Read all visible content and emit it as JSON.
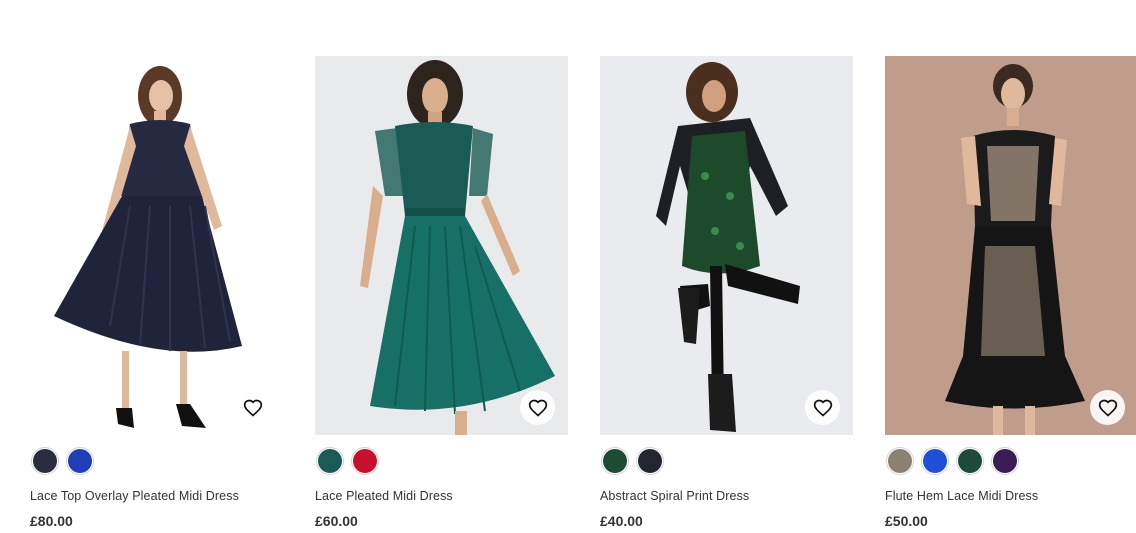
{
  "products": [
    {
      "name": "Lace Top Overlay Pleated Midi Dress",
      "price": "£80.00",
      "swatches": [
        {
          "color": "#2a2d3e"
        },
        {
          "color": "#1f3fb8"
        }
      ]
    },
    {
      "name": "Lace Pleated Midi Dress",
      "price": "£60.00",
      "swatches": [
        {
          "color": "#1b5a55"
        },
        {
          "color": "#c8102e"
        }
      ]
    },
    {
      "name": "Abstract Spiral Print Dress",
      "price": "£40.00",
      "swatches": [
        {
          "color": "#1f4a33"
        },
        {
          "color": "#23262e"
        }
      ]
    },
    {
      "name": "Flute Hem Lace Midi Dress",
      "price": "£50.00",
      "swatches": [
        {
          "color": "#8b8170"
        },
        {
          "color": "#1f4fd6"
        },
        {
          "color": "#1d4a3a"
        },
        {
          "color": "#3a1d55"
        }
      ]
    }
  ],
  "icons": {
    "wishlist": "heart-outline-icon"
  }
}
